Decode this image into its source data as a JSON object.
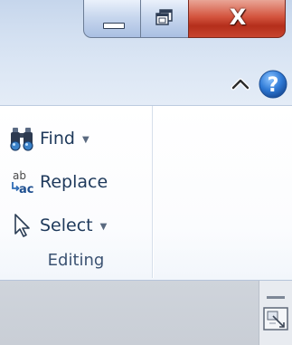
{
  "window": {
    "minimize_icon": "minimize-icon",
    "maximize_icon": "restore-icon",
    "close_icon": "close-icon",
    "close_glyph": "X"
  },
  "ribbon_tabs": {
    "collapse_icon": "chevron-up-icon",
    "help_icon": "help-icon",
    "help_glyph": "?"
  },
  "editing_group": {
    "label": "Editing",
    "commands": [
      {
        "label": "Find",
        "icon": "binoculars-icon",
        "has_dropdown": true
      },
      {
        "label": "Replace",
        "icon": "replace-icon",
        "has_dropdown": false
      },
      {
        "label": "Select",
        "icon": "cursor-arrow-icon",
        "has_dropdown": true
      }
    ],
    "dropdown_glyph": "▼"
  },
  "status": {
    "view_toggle_icon": "view-toggle-icon"
  },
  "colors": {
    "title_bar": "#d3e0f1",
    "close_button": "#c8452f",
    "label_text": "#1e395b",
    "group_label": "#3b5272",
    "help_blue": "#2f7ad6"
  }
}
